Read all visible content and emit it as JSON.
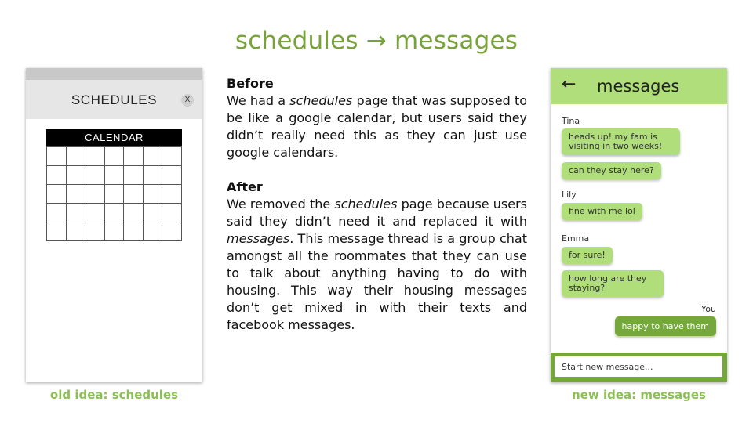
{
  "slide_title": "schedules → messages",
  "old_phone": {
    "header_title": "SCHEDULES",
    "close_label": "X",
    "calendar_title": "CALENDAR",
    "caption": "old idea: schedules"
  },
  "before": {
    "heading": "Before",
    "text_1": "We had a ",
    "text_2": "schedules",
    "text_3": " page that was supposed to be like a google calendar, but users said they didn’t really need this as they can just use google calendars."
  },
  "after": {
    "heading": "After",
    "text_1": "We removed the ",
    "text_2": "schedules",
    "text_3": " page because users said they didn’t need it and replaced it with ",
    "text_4": "messages",
    "text_5": ". This message thread is a group chat amongst all the roommates that they can use to talk about anything having to do with housing. This way their housing messages don’t get mixed in with their texts and facebook messages."
  },
  "new_phone": {
    "back_icon": "←",
    "title": "messages",
    "messages": [
      {
        "sender": "Tina",
        "bubbles": [
          "heads up! my fam is visiting in two weeks!",
          "can they stay here?"
        ]
      },
      {
        "sender": "Lily",
        "bubbles": [
          "fine with me lol"
        ]
      },
      {
        "sender": "Emma",
        "bubbles": [
          "for sure!",
          "how long are they staying?"
        ]
      }
    ],
    "own": {
      "sender": "You",
      "text": "happy to have them"
    },
    "composer_placeholder": "Start new message...",
    "caption": "new idea: messages"
  },
  "colors": {
    "title_green": "#78a33a",
    "bubble_green": "#b0de7b",
    "dark_green": "#74a83a",
    "caption_green": "#8cbf55"
  }
}
